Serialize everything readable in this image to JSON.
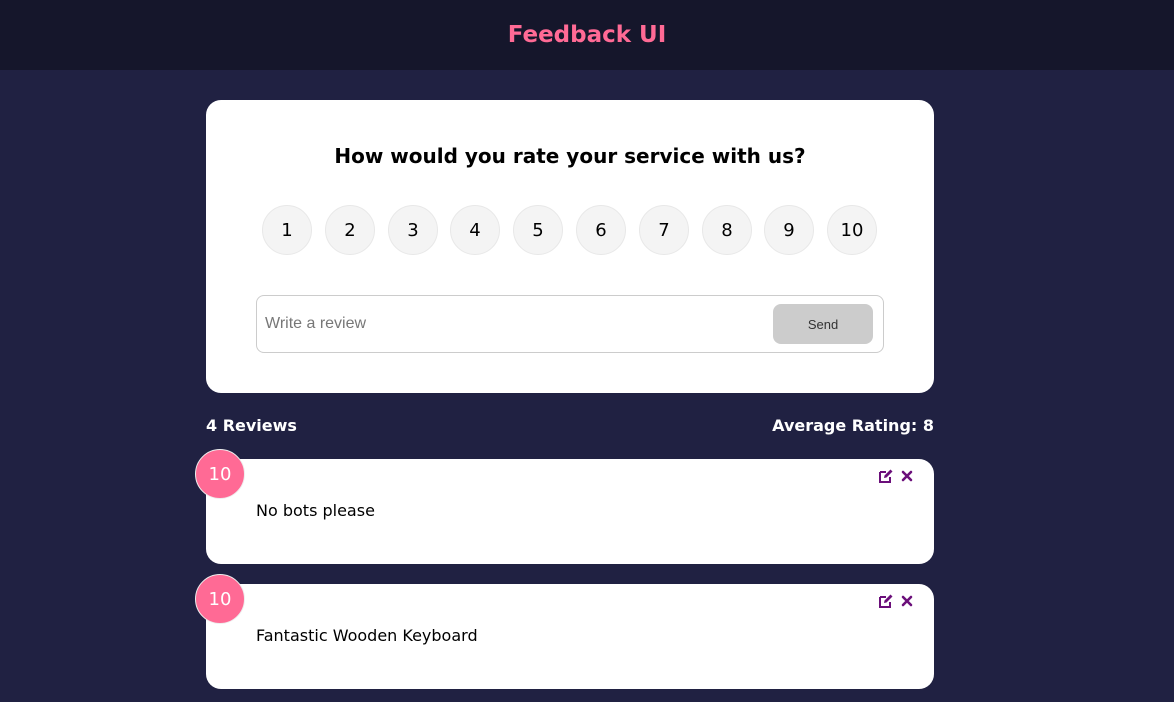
{
  "header": {
    "title": "Feedback UI"
  },
  "form": {
    "question": "How would you rate your service with us?",
    "ratings": [
      "1",
      "2",
      "3",
      "4",
      "5",
      "6",
      "7",
      "8",
      "9",
      "10"
    ],
    "input": {
      "placeholder": "Write a review",
      "value": ""
    },
    "send_label": "Send"
  },
  "stats": {
    "count_label": "4 Reviews",
    "average_label": "Average Rating: 8"
  },
  "reviews": [
    {
      "rating": "10",
      "text": "No bots please"
    },
    {
      "rating": "10",
      "text": "Fantastic Wooden Keyboard"
    }
  ],
  "icons": {
    "edit": "edit-icon",
    "close": "close-icon"
  },
  "colors": {
    "accent": "#ff6a95",
    "background": "#202142",
    "header_background": "#15162b",
    "icon": "#6b0f7a"
  }
}
